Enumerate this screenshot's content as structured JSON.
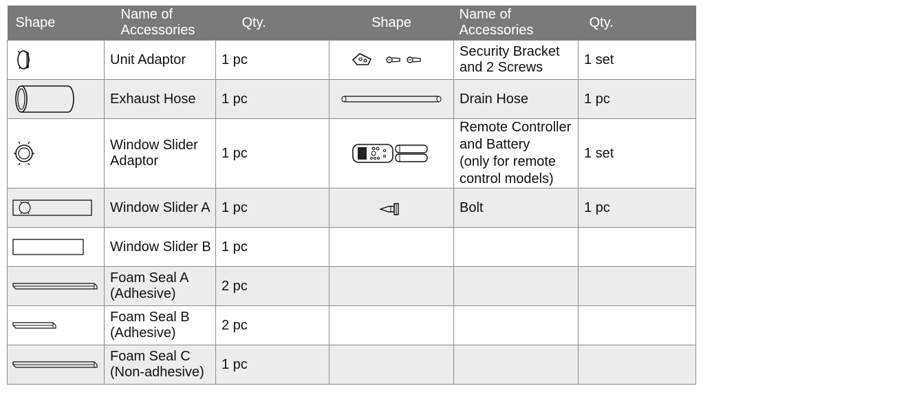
{
  "headers": {
    "shape_left": "Shape",
    "name_left": "Name of Accessories",
    "qty_left": "Qty.",
    "shape_right": "Shape",
    "name_right": "Name of Accessories",
    "qty_right": "Qty."
  },
  "rows": [
    {
      "left_icon": "unit-adaptor-icon",
      "left_name": "Unit Adaptor",
      "left_qty": "1 pc",
      "right_icon": "security-bracket-screws-icon",
      "right_name": "Security Bracket and 2 Screws",
      "right_qty": "1 set"
    },
    {
      "left_icon": "exhaust-hose-icon",
      "left_name": "Exhaust Hose",
      "left_qty": "1 pc",
      "right_icon": "drain-hose-icon",
      "right_name": "Drain Hose",
      "right_qty": "1 pc"
    },
    {
      "left_icon": "window-slider-adaptor-icon",
      "left_name": "Window Slider Adaptor",
      "left_qty": "1 pc",
      "right_icon": "remote-controller-battery-icon",
      "right_name_line1": "Remote Controller and Battery",
      "right_name_line2": "(only for remote control models)",
      "right_qty": "1 set"
    },
    {
      "left_icon": "window-slider-a-icon",
      "left_name": "Window Slider A",
      "left_qty": "1 pc",
      "right_icon": "bolt-icon",
      "right_name": "Bolt",
      "right_qty": "1 pc"
    },
    {
      "left_icon": "window-slider-b-icon",
      "left_name": "Window Slider B",
      "left_qty": "1 pc"
    },
    {
      "left_icon": "foam-seal-a-icon",
      "left_name": "Foam Seal A (Adhesive)",
      "left_qty": "2 pc"
    },
    {
      "left_icon": "foam-seal-b-icon",
      "left_name": "Foam Seal B (Adhesive)",
      "left_qty": "2 pc"
    },
    {
      "left_icon": "foam-seal-c-icon",
      "left_name": "Foam Seal C (Non-adhesive)",
      "left_qty": "1 pc"
    }
  ],
  "colors": {
    "header_bg": "#7a7a7a",
    "header_text": "#ffffff",
    "alt_row_bg": "#ececec",
    "border": "#8a8a8a"
  }
}
